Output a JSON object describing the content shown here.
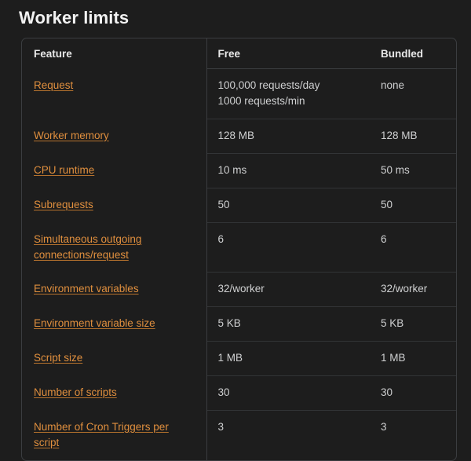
{
  "page": {
    "title": "Worker limits",
    "accent_color": "#e08f3e",
    "background_color": "#1d1d1d",
    "border_color": "#3b3d40",
    "value_text_color": "#cfd0d1"
  },
  "table": {
    "columns": [
      {
        "key": "feature",
        "label": "Feature"
      },
      {
        "key": "free",
        "label": "Free"
      },
      {
        "key": "bundled",
        "label": "Bundled"
      }
    ],
    "rows": [
      {
        "feature": "Request",
        "free_lines": [
          "100,000 requests/day",
          "1000 requests/min"
        ],
        "bundled_lines": [
          "none"
        ]
      },
      {
        "feature": "Worker memory",
        "free_lines": [
          "128 MB"
        ],
        "bundled_lines": [
          "128 MB"
        ]
      },
      {
        "feature": "CPU runtime",
        "free_lines": [
          "10 ms"
        ],
        "bundled_lines": [
          "50 ms"
        ]
      },
      {
        "feature": "Subrequests",
        "free_lines": [
          "50"
        ],
        "bundled_lines": [
          "50"
        ]
      },
      {
        "feature": "Simultaneous outgoing connections/request",
        "free_lines": [
          "6"
        ],
        "bundled_lines": [
          "6"
        ]
      },
      {
        "feature": "Environment variables",
        "free_lines": [
          "32/worker"
        ],
        "bundled_lines": [
          "32/worker"
        ]
      },
      {
        "feature": "Environment variable size",
        "free_lines": [
          "5 KB"
        ],
        "bundled_lines": [
          "5 KB"
        ]
      },
      {
        "feature": "Script size",
        "free_lines": [
          "1 MB"
        ],
        "bundled_lines": [
          "1 MB"
        ]
      },
      {
        "feature": "Number of scripts",
        "free_lines": [
          "30"
        ],
        "bundled_lines": [
          "30"
        ]
      },
      {
        "feature": "Number of Cron Triggers per script",
        "free_lines": [
          "3"
        ],
        "bundled_lines": [
          "3"
        ]
      }
    ]
  }
}
